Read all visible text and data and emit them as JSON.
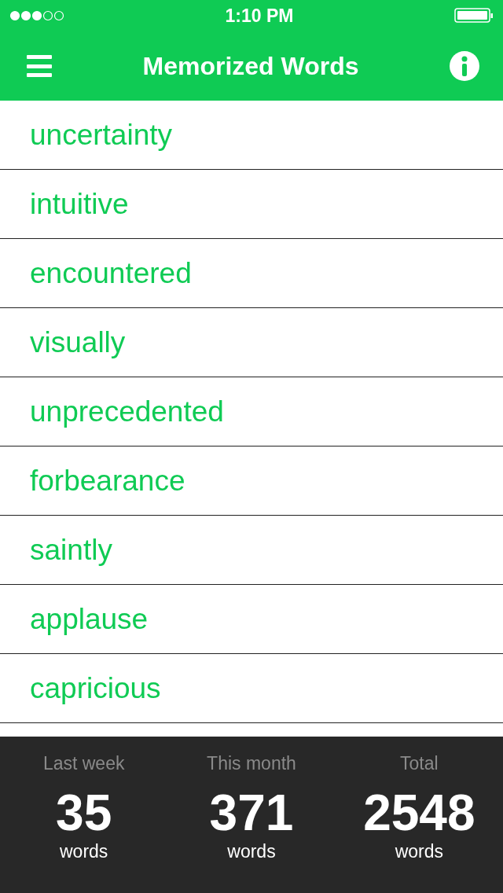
{
  "status_bar": {
    "time": "1:10 PM"
  },
  "nav_bar": {
    "title": "Memorized Words"
  },
  "words": [
    "uncertainty",
    "intuitive",
    "encountered",
    "visually",
    "unprecedented",
    "forbearance",
    "saintly",
    "applause",
    "capricious"
  ],
  "stats": [
    {
      "label": "Last week",
      "value": "35",
      "unit": "words"
    },
    {
      "label": "This month",
      "value": "371",
      "unit": "words"
    },
    {
      "label": "Total",
      "value": "2548",
      "unit": "words"
    }
  ]
}
